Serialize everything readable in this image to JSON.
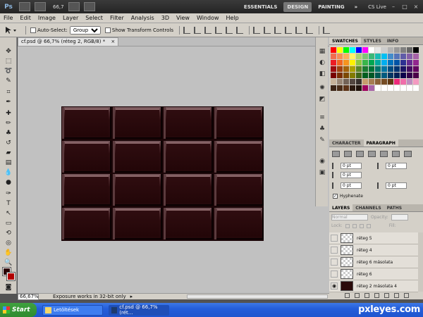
{
  "app": {
    "logo": "Ps",
    "zoom_display": "66,7",
    "workspaces": [
      "ESSENTIALS",
      "DESIGN",
      "PAINTING"
    ],
    "active_workspace": "DESIGN",
    "more": "»",
    "cs_live": "CS Live"
  },
  "menu": [
    "File",
    "Edit",
    "Image",
    "Layer",
    "Select",
    "Filter",
    "Analysis",
    "3D",
    "View",
    "Window",
    "Help"
  ],
  "options": {
    "auto_select_label": "Auto-Select:",
    "auto_select_value": "Group",
    "show_transform_label": "Show Transform Controls"
  },
  "document": {
    "tab_title": "cf.psd @ 66,7% (réteg 2, RGB/8) *",
    "close": "×",
    "zoom": "66,67%",
    "status_info": "Exposure works in 32-bit only"
  },
  "foreground_color": "#2b0000",
  "background_color": "#b00000",
  "swatches_panel": {
    "tabs": [
      "SWATCHES",
      "STYLES",
      "INFO"
    ],
    "active_tab": "SWATCHES"
  },
  "character_panel": {
    "tabs": [
      "CHARACTER",
      "PARAGRAPH"
    ],
    "active_tab": "PARAGRAPH",
    "fields": [
      "0 pt",
      "0 pt",
      "0 pt",
      "0 pt",
      "0 pt"
    ],
    "hyphenate_label": "Hyphenate",
    "hyphenate_checked": true
  },
  "layers_panel": {
    "tabs": [
      "LAYERS",
      "CHANNELS",
      "PATHS"
    ],
    "active_tab": "LAYERS",
    "blend_mode": "Normal",
    "opacity_label": "Opacity:",
    "fill_label": "Fill:",
    "lock_label": "Lock:",
    "layers": [
      {
        "name": "réteg 5",
        "visible": false
      },
      {
        "name": "réteg 4",
        "visible": false
      },
      {
        "name": "réteg 6 másolata",
        "visible": false
      },
      {
        "name": "réteg 6",
        "visible": false
      },
      {
        "name": "réteg 2 másolata 4",
        "visible": true
      }
    ]
  },
  "taskbar": {
    "start": "Start",
    "tasks": [
      "Letöltések",
      "cf.psd @ 66,7% (rét..."
    ]
  },
  "watermark": "pxleyes.com"
}
